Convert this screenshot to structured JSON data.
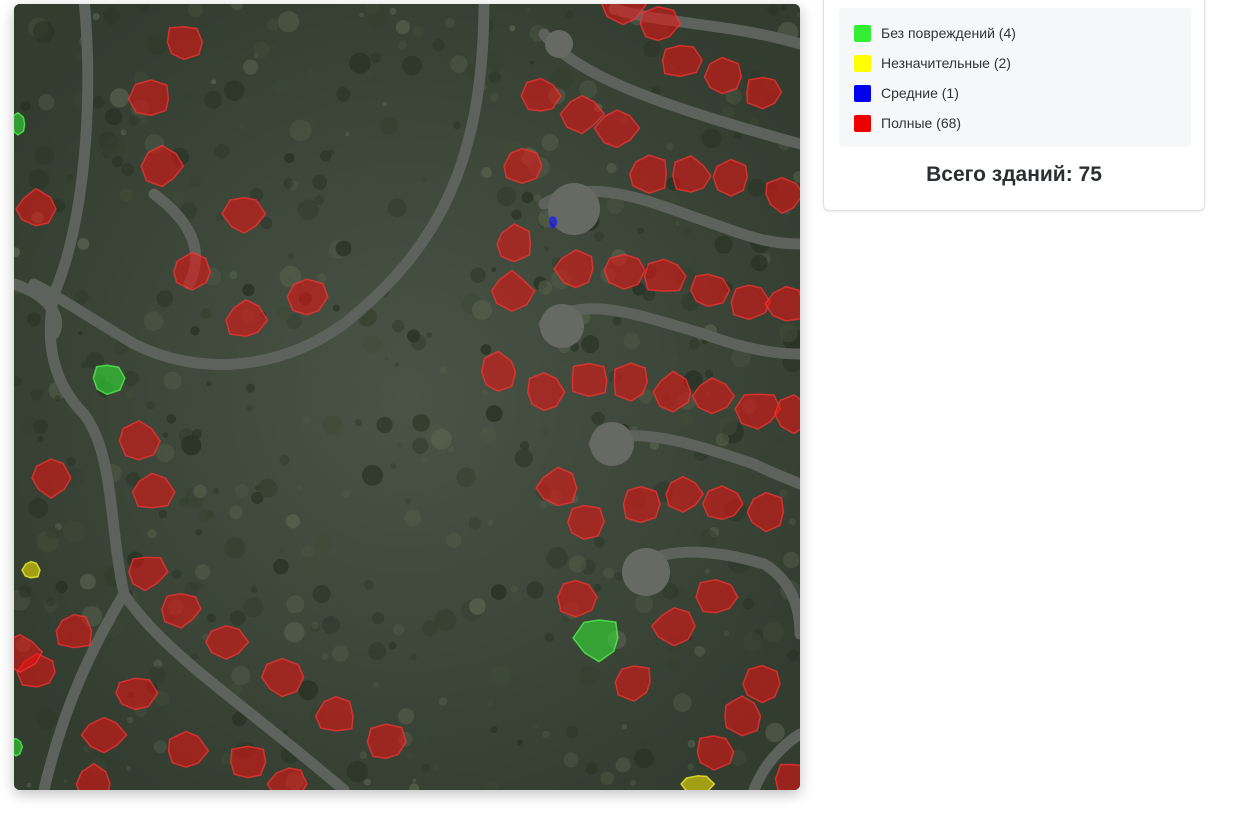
{
  "map": {
    "image_label": "satellite-damage-map"
  },
  "legend": {
    "items": [
      {
        "label": "Без повреждений (4)",
        "color": "#33ee33"
      },
      {
        "label": "Незначительные (2)",
        "color": "#ffff00"
      },
      {
        "label": "Средние (1)",
        "color": "#0000ee"
      },
      {
        "label": "Полные (68)",
        "color": "#ee0000"
      }
    ]
  },
  "summary": {
    "total_label": "Всего зданий: 75"
  }
}
